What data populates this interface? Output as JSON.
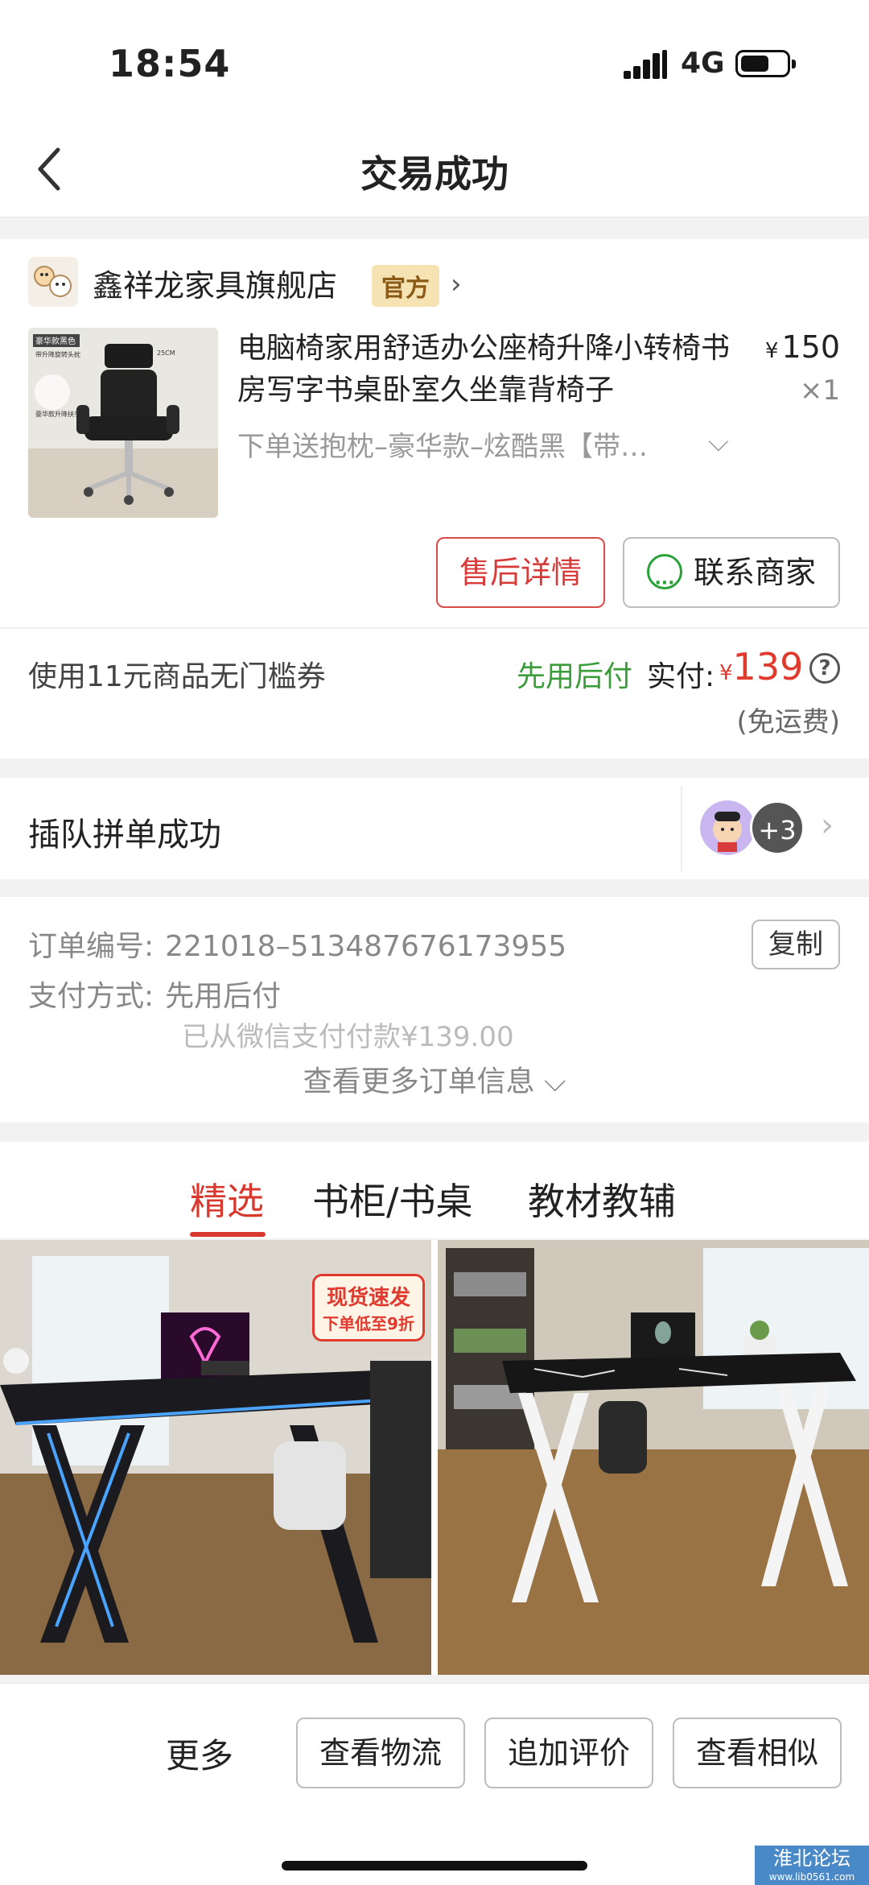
{
  "status": {
    "time": "18:54",
    "network": "4G"
  },
  "nav": {
    "title": "交易成功"
  },
  "store": {
    "name": "鑫祥龙家具旗舰店",
    "badge": "官方"
  },
  "product": {
    "title": "电脑椅家用舒适办公座椅升降小转椅书房写字书桌卧室久坐靠背椅子",
    "price_symbol": "¥",
    "price": "150",
    "quantity": "×1",
    "sku": "下单送抱枕–豪华款–炫酷黑【带…",
    "image_labels": {
      "tag1": "豪华款黑色",
      "tag2": "带升降旋转头枕",
      "size": "25CM",
      "tag3": "豪华款升降扶手"
    }
  },
  "actions": {
    "after_sales": "售后详情",
    "contact_seller": "联系商家"
  },
  "payment": {
    "coupon": "使用11元商品无门槛券",
    "pay_later": "先用后付",
    "paid_label": "实付:",
    "currency": "¥",
    "paid_amount": "139",
    "freight": "(免运费)"
  },
  "group": {
    "text": "插队拼单成功",
    "more_count": "+3"
  },
  "order": {
    "id_label": "订单编号:",
    "id_value": "221018–513487676173955",
    "copy": "复制",
    "method_label": "支付方式:",
    "method_value": "先用后付",
    "paid_note": "已从微信支付付款¥139.00",
    "more_info": "查看更多订单信息"
  },
  "tabs": [
    {
      "label": "精选",
      "active": true
    },
    {
      "label": "书柜/书桌",
      "active": false
    },
    {
      "label": "教材教辅",
      "active": false
    }
  ],
  "recommend": {
    "promo_line1": "现货速发",
    "promo_line2": "下单低至9折"
  },
  "bottom": {
    "more": "更多",
    "logistics": "查看物流",
    "add_review": "追加评价",
    "similar": "查看相似"
  },
  "watermark": {
    "text": "淮北论坛",
    "url": "www.lib0561.com"
  },
  "colors": {
    "accent_red": "#d8382e",
    "pay_green": "#3a9d3a",
    "official_bg": "#f6e3b3"
  }
}
